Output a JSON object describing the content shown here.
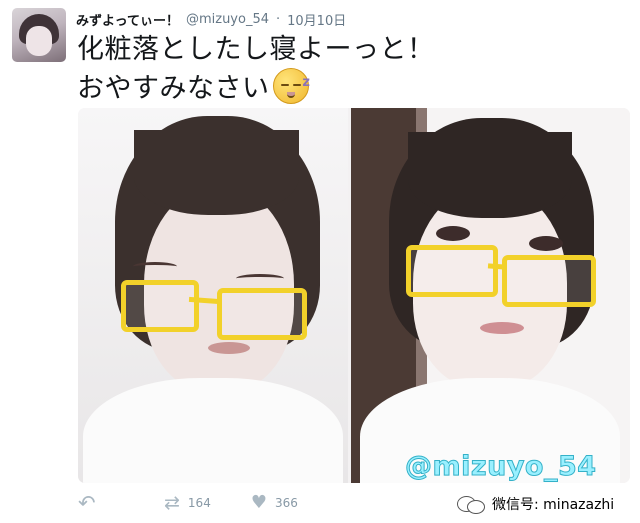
{
  "tweet": {
    "display_name": "みずよってぃー！",
    "handle": "@mizuyo_54",
    "separator": "·",
    "date": "10月10日",
    "text_line1": "化粧落としたし寝よーっと！",
    "text_line2": "おやすみなさい",
    "emoji": "sleeping-face-icon",
    "photo_watermark": "@mizuyo_54"
  },
  "actions": {
    "reply_icon": "reply-icon",
    "retweets": "164",
    "likes": "366"
  },
  "footer": {
    "wechat_label": "微信号: minazazhi"
  },
  "colors": {
    "glasses": "#f2d12a",
    "watermark": "#9af0ff",
    "muted": "#657786"
  }
}
